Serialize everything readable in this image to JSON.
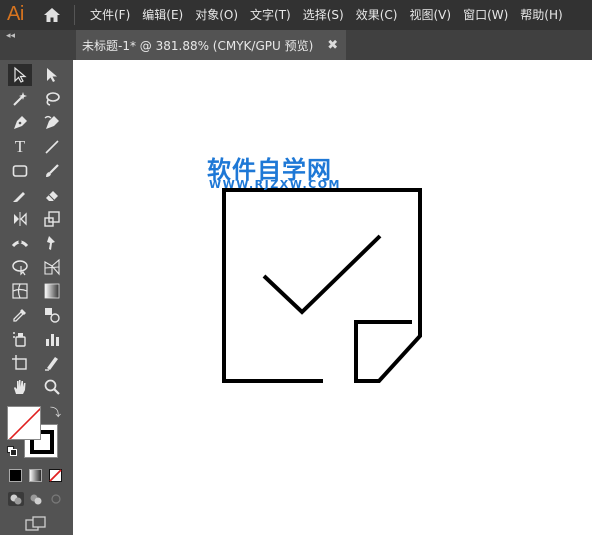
{
  "app": {
    "logo": "Ai"
  },
  "menu": {
    "items": [
      "文件(F)",
      "编辑(E)",
      "对象(O)",
      "文字(T)",
      "选择(S)",
      "效果(C)",
      "视图(V)",
      "窗口(W)",
      "帮助(H)"
    ]
  },
  "tabs": {
    "collapse_glyph": "◂◂",
    "active_title": "未标题-1* @ 381.88% (CMYK/GPU 预览)",
    "close_glyph": "✖"
  },
  "toolbar": {
    "type_tool_glyph": "T",
    "swap_glyph": "⤵",
    "tools": [
      "selection-tool",
      "direct-selection-tool",
      "magic-wand-tool",
      "lasso-tool",
      "pen-tool",
      "curvature-tool",
      "type-tool",
      "line-segment-tool",
      "rectangle-tool",
      "paintbrush-tool",
      "shaper-tool",
      "eraser-tool",
      "rotate-tool",
      "scale-tool",
      "width-tool",
      "puppet-warp-tool",
      "shape-builder-tool",
      "perspective-grid-tool",
      "mesh-tool",
      "gradient-tool",
      "eyedropper-tool",
      "blend-tool",
      "symbol-sprayer-tool",
      "column-graph-tool",
      "artboard-tool",
      "slice-tool",
      "hand-tool",
      "zoom-tool"
    ],
    "fill_color": "#ffffff",
    "stroke_color": "#000000"
  },
  "canvas": {
    "watermark_text": "软件自学网",
    "watermark_url": "WWW.RJZXW.COM",
    "watermark_color": "#1e78d6",
    "art_stroke_color": "#000000"
  },
  "colors": {
    "menubar_bg": "#323232",
    "panel_bg": "#535353",
    "tab_bg": "#404040",
    "accent_logo": "#d7741f"
  }
}
